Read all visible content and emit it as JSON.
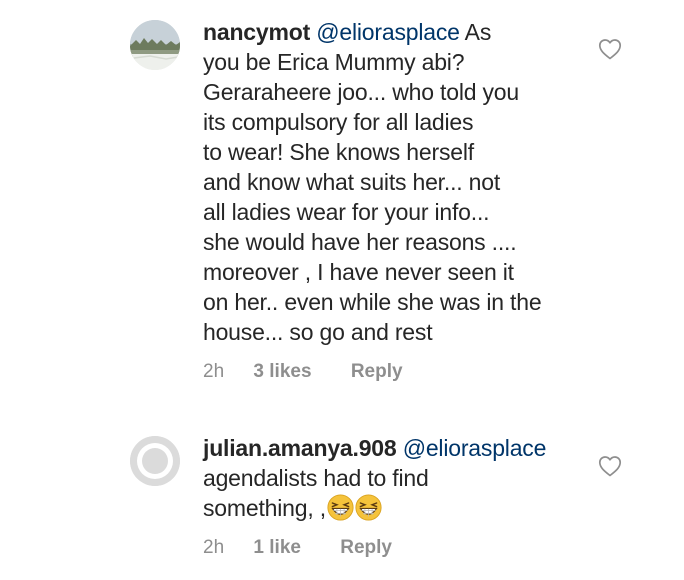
{
  "comments": [
    {
      "username": "nancymot",
      "mention": "@eliorasplace",
      "lines_first": "As",
      "lines": [
        "you be Erica Mummy abi?",
        "Geraraheere joo... who told you",
        "its compulsory for all ladies",
        "to wear! She knows herself",
        "and know what suits her... not",
        "all ladies wear for your info...",
        "she would have her reasons ....",
        "moreover , I have never seen it",
        "on her.. even while she was in the",
        "house... so go and rest"
      ],
      "time": "2h",
      "likes": "3 likes",
      "reply": "Reply",
      "avatar_icon": "profile-photo-landscape",
      "like_icon": "heart-outline-icon"
    },
    {
      "username": "julian.amanya.908",
      "mention": "@eliorasplace",
      "lines": [
        "agendalists had to find",
        "something, ,"
      ],
      "emojis": [
        "grinning-squinting-face-emoji",
        "grinning-squinting-face-emoji"
      ],
      "time": "2h",
      "likes": "1 like",
      "reply": "Reply",
      "avatar_icon": "default-avatar-icon",
      "like_icon": "heart-outline-icon"
    }
  ],
  "colors": {
    "text": "#262626",
    "mention": "#003569",
    "meta": "#8e8e8e",
    "emoji_face": "#f5c33b"
  }
}
